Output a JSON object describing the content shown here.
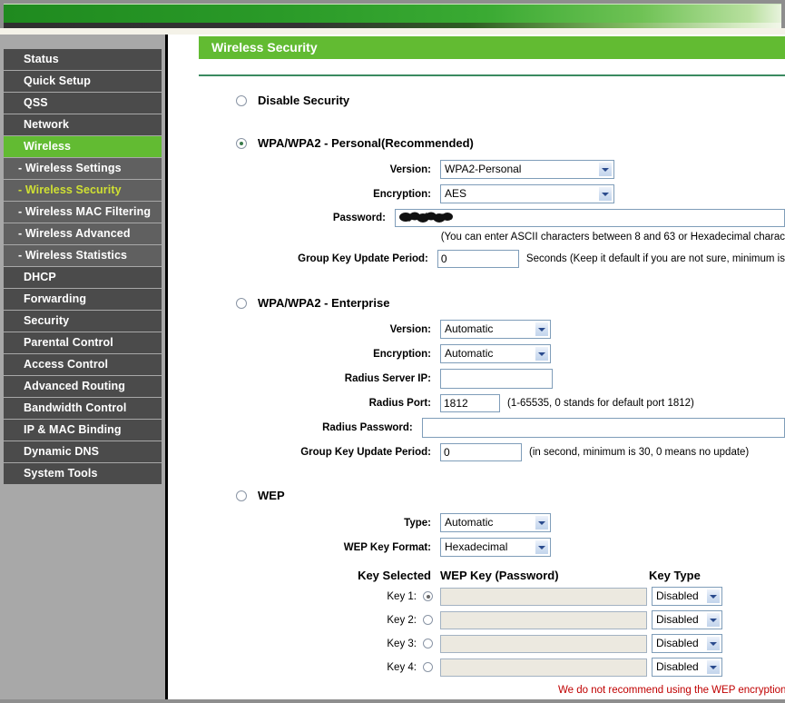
{
  "sidebar": {
    "items": [
      {
        "label": "Status",
        "type": "top",
        "state": "normal"
      },
      {
        "label": "Quick Setup",
        "type": "top",
        "state": "normal"
      },
      {
        "label": "QSS",
        "type": "top",
        "state": "normal"
      },
      {
        "label": "Network",
        "type": "top",
        "state": "normal"
      },
      {
        "label": "Wireless",
        "type": "top",
        "state": "active"
      },
      {
        "label": "- Wireless Settings",
        "type": "sub",
        "state": "normal"
      },
      {
        "label": "- Wireless Security",
        "type": "sub",
        "state": "sub-active"
      },
      {
        "label": "- Wireless MAC Filtering",
        "type": "sub",
        "state": "normal"
      },
      {
        "label": "- Wireless Advanced",
        "type": "sub",
        "state": "normal"
      },
      {
        "label": "- Wireless Statistics",
        "type": "sub",
        "state": "normal"
      },
      {
        "label": "DHCP",
        "type": "top",
        "state": "normal"
      },
      {
        "label": "Forwarding",
        "type": "top",
        "state": "normal"
      },
      {
        "label": "Security",
        "type": "top",
        "state": "normal"
      },
      {
        "label": "Parental Control",
        "type": "top",
        "state": "normal"
      },
      {
        "label": "Access Control",
        "type": "top",
        "state": "normal"
      },
      {
        "label": "Advanced Routing",
        "type": "top",
        "state": "normal"
      },
      {
        "label": "Bandwidth Control",
        "type": "top",
        "state": "normal"
      },
      {
        "label": "IP & MAC Binding",
        "type": "top",
        "state": "normal"
      },
      {
        "label": "Dynamic DNS",
        "type": "top",
        "state": "normal"
      },
      {
        "label": "System Tools",
        "type": "top",
        "state": "normal"
      }
    ]
  },
  "page": {
    "title": "Wireless Security"
  },
  "disable_security": {
    "label": "Disable Security",
    "selected": false
  },
  "wpa_personal": {
    "label": "WPA/WPA2 - Personal(Recommended)",
    "selected": true,
    "version_label": "Version:",
    "version_value": "WPA2-Personal",
    "encryption_label": "Encryption:",
    "encryption_value": "AES",
    "password_label": "Password:",
    "password_value": "",
    "password_hint": "(You can enter ASCII characters between 8 and 63 or Hexadecimal charac",
    "group_key_label": "Group Key Update Period:",
    "group_key_value": "0",
    "group_key_hint": "Seconds (Keep it default if you are not sure, minimum is"
  },
  "wpa_enterprise": {
    "label": "WPA/WPA2 - Enterprise",
    "selected": false,
    "version_label": "Version:",
    "version_value": "Automatic",
    "encryption_label": "Encryption:",
    "encryption_value": "Automatic",
    "radius_ip_label": "Radius Server IP:",
    "radius_ip_value": "",
    "radius_port_label": "Radius Port:",
    "radius_port_value": "1812",
    "radius_port_hint": "(1-65535, 0 stands for default port 1812)",
    "radius_password_label": "Radius Password:",
    "radius_password_value": "",
    "group_key_label": "Group Key Update Period:",
    "group_key_value": "0",
    "group_key_hint": "(in second, minimum is 30, 0 means no update)"
  },
  "wep": {
    "label": "WEP",
    "selected": false,
    "type_label": "Type:",
    "type_value": "Automatic",
    "format_label": "WEP Key Format:",
    "format_value": "Hexadecimal",
    "col_key_selected": "Key Selected",
    "col_wep_key": "WEP Key (Password)",
    "col_key_type": "Key Type",
    "keys": [
      {
        "label": "Key 1:",
        "selected": true,
        "value": "",
        "type": "Disabled"
      },
      {
        "label": "Key 2:",
        "selected": false,
        "value": "",
        "type": "Disabled"
      },
      {
        "label": "Key 3:",
        "selected": false,
        "value": "",
        "type": "Disabled"
      },
      {
        "label": "Key 4:",
        "selected": false,
        "value": "",
        "type": "Disabled"
      }
    ],
    "warning": "We do not recommend using the WEP encryption if the device operates in"
  },
  "colors": {
    "accent_green": "#62bb32",
    "sidebar_item": "#4b4b4b",
    "sidebar_sub": "#606060",
    "sub_active_text": "#cfe033",
    "warning_red": "#c00000"
  }
}
